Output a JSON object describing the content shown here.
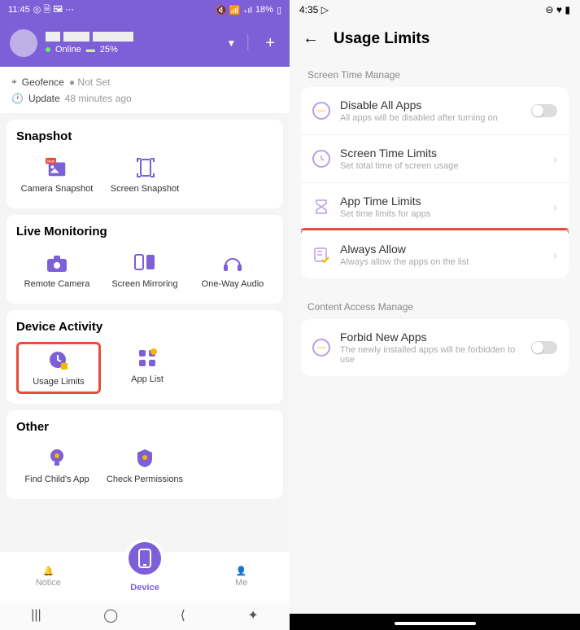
{
  "left": {
    "status": {
      "time": "11:45",
      "battery": "18%"
    },
    "header": {
      "online": "Online",
      "battery": "25%"
    },
    "info": {
      "geofence_label": "Geofence",
      "geofence_value": "Not Set",
      "update_label": "Update",
      "update_value": "48 minutes ago"
    },
    "snapshot": {
      "title": "Snapshot",
      "items": [
        "Camera Snapshot",
        "Screen Snapshot"
      ]
    },
    "monitoring": {
      "title": "Live Monitoring",
      "items": [
        "Remote Camera",
        "Screen Mirroring",
        "One-Way Audio"
      ]
    },
    "activity": {
      "title": "Device Activity",
      "items": [
        "Usage Limits",
        "App List"
      ]
    },
    "other": {
      "title": "Other",
      "items": [
        "Find Child's App",
        "Check Permissions"
      ]
    },
    "nav": {
      "notice": "Notice",
      "device": "Device",
      "me": "Me"
    }
  },
  "right": {
    "status": {
      "time": "4:35"
    },
    "title": "Usage Limits",
    "section1": "Screen Time Manage",
    "rows1": [
      {
        "title": "Disable All Apps",
        "sub": "All apps will be disabled after turning on"
      },
      {
        "title": "Screen Time Limits",
        "sub": "Set total time of screen usage"
      },
      {
        "title": "App Time Limits",
        "sub": "Set time limits for apps"
      },
      {
        "title": "Always Allow",
        "sub": "Always allow the apps on the list"
      }
    ],
    "section2": "Content Access Manage",
    "rows2": [
      {
        "title": "Forbid New Apps",
        "sub": "The newly installed apps will be forbidden to use"
      }
    ]
  }
}
